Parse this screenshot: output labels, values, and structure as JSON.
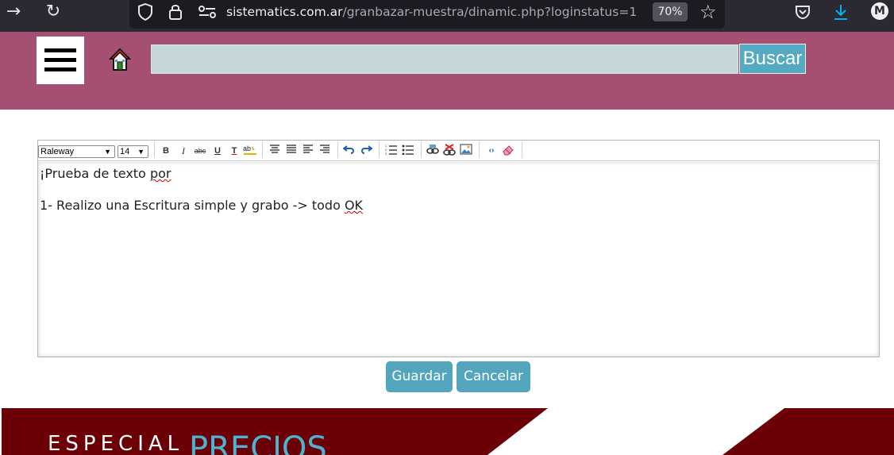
{
  "browser": {
    "url_domain": "sistematics.com.ar",
    "url_path": "/granbazar-muestra/dinamic.php?loginstatus=1",
    "zoom": "70%",
    "avatar_letter": "M",
    "icons": [
      "forward-icon",
      "reload-icon",
      "shield-icon",
      "lock-icon",
      "permissions-icon",
      "bookmark-star-icon",
      "pocket-icon",
      "download-icon"
    ]
  },
  "header": {
    "search_placeholder": "",
    "search_button": "Buscar",
    "colors": {
      "header_bg": "#a54f73",
      "search_bg": "#c6d7dc",
      "accent": "#55a9c0"
    }
  },
  "editor": {
    "font": "Raleway",
    "size": "14",
    "toolbar_buttons": [
      "bold",
      "italic",
      "strikethrough",
      "underline",
      "remove-format",
      "spellcheck",
      "align-left",
      "align-center",
      "align-justify",
      "align-right",
      "undo",
      "redo",
      "ordered-list",
      "unordered-list",
      "link",
      "unlink",
      "image",
      "source-code",
      "eraser"
    ],
    "line1_pre": "¡Prueba de texto ",
    "line1_err": "por",
    "line2_pre": "1- Realizo una Escritura simple y grabo -> todo ",
    "line2_err": "OK"
  },
  "actions": {
    "save": "Guardar",
    "cancel": "Cancelar"
  },
  "banner": {
    "text1": "ESPECIAL",
    "text2": "PRECIOS",
    "colors": {
      "bg": "#6b0006",
      "accent": "#4fb3cf"
    }
  }
}
